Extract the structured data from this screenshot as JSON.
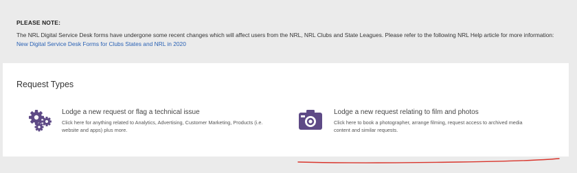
{
  "notice": {
    "title": "PLEASE NOTE:",
    "text": "The NRL Digital Service Desk forms have undergone some recent changes which will affect users from the NRL, NRL Clubs and State Leagues. Please refer to the following NRL Help article for more information:",
    "link_text": "New Digital Service Desk Forms for Clubs States and NRL in 2020"
  },
  "request_types": {
    "heading": "Request Types",
    "items": [
      {
        "icon": "gears-icon",
        "title": "Lodge a new request or flag a technical issue",
        "description": "Click here for anything related to Analytics, Advertising, Customer Marketing, Products (i.e. website and apps) plus more."
      },
      {
        "icon": "camera-icon",
        "title": "Lodge a new request relating to film and photos",
        "description": "Click here to book a photographer, arrange filming, request access to archived media content and similar requests."
      }
    ]
  },
  "colors": {
    "icon_purple": "#5e4a86",
    "link_blue": "#2a62b5",
    "annotation_red": "#d9342b"
  }
}
